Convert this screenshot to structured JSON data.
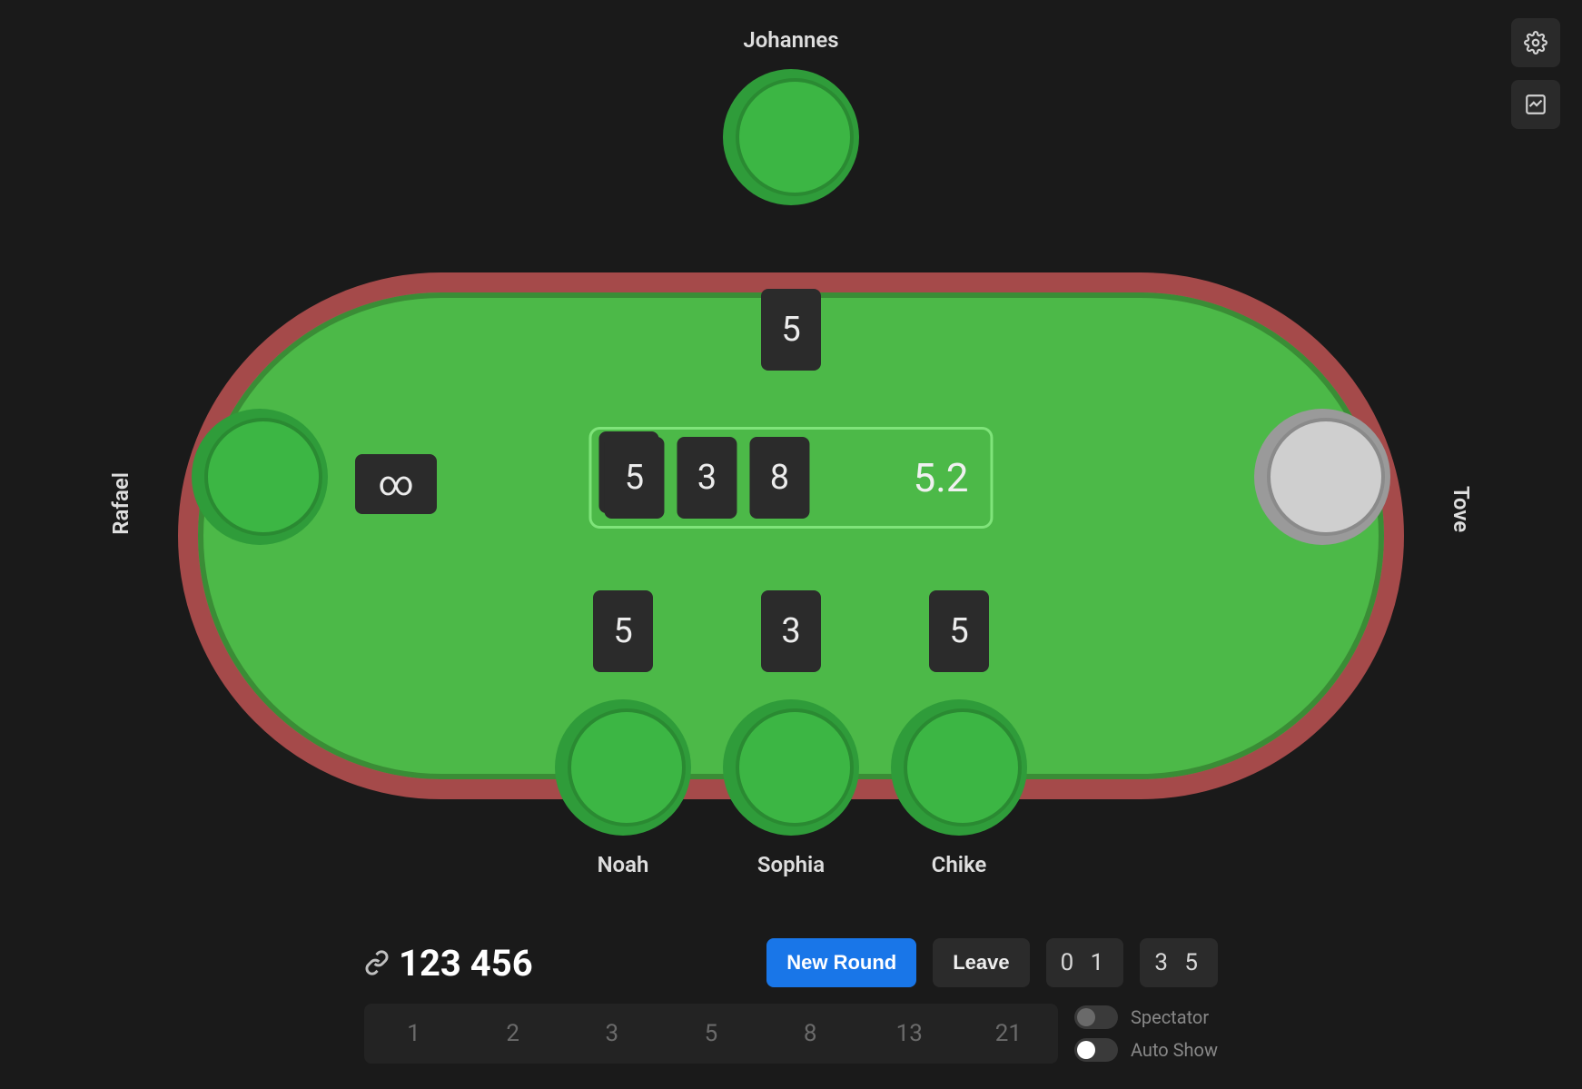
{
  "players": {
    "top": {
      "name": "Johannes",
      "chip": "green",
      "card": "5"
    },
    "left": {
      "name": "Rafael",
      "chip": "green",
      "card": "∞"
    },
    "right": {
      "name": "Tove",
      "chip": "gray",
      "card": ""
    },
    "bottom": [
      {
        "name": "Noah",
        "chip": "green",
        "card": "5"
      },
      {
        "name": "Sophia",
        "chip": "green",
        "card": "3"
      },
      {
        "name": "Chike",
        "chip": "green",
        "card": "5"
      }
    ]
  },
  "pot": {
    "cards": [
      "5",
      "3",
      "8"
    ],
    "average": "5.2"
  },
  "footer": {
    "room_code": "123 456",
    "new_round_label": "New Round",
    "leave_label": "Leave",
    "time1": "0 1",
    "time2": "3 5",
    "vote_options": [
      "1",
      "2",
      "3",
      "5",
      "8",
      "13",
      "21"
    ],
    "toggles": {
      "spectator": {
        "label": "Spectator",
        "on": false
      },
      "auto_show": {
        "label": "Auto Show",
        "on": true
      }
    }
  }
}
